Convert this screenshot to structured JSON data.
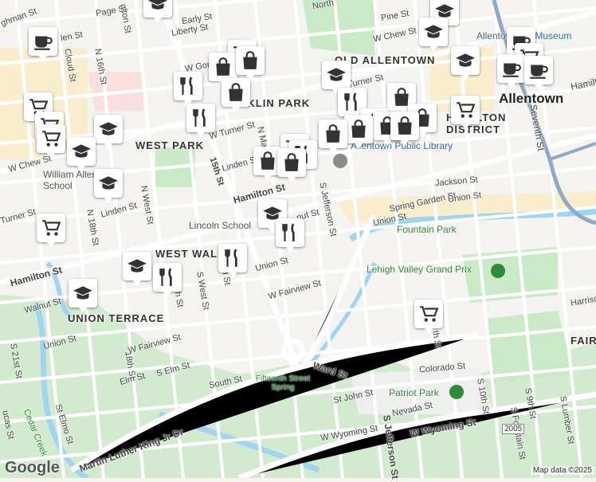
{
  "map": {
    "city_label": "Allentown",
    "neighborhoods": [
      "OLD ALLENTOWN",
      "NKLIN PARK",
      "WEST PARK",
      "HAMILTON DISTRICT",
      "WEST WALNUT",
      "UNION TERRACE",
      "FAIR"
    ],
    "streets": [
      "ghman St",
      "Page St",
      "Early St",
      "Liberty St",
      "N 16th St",
      "ulton St",
      "Cloud St",
      "len St",
      "W Gor",
      "W Chew St",
      "Pine St",
      "North",
      "Turner St",
      "W Turner St",
      "W Chew St",
      "Linden St",
      "Linden St",
      "N 18th St",
      "N West St",
      "15th St",
      "N Mar",
      "Turner St",
      "Hamilton St",
      "Hamilton St",
      "nut St",
      "S Jefferson St",
      "Jackson St",
      "Spring Garden St",
      "Union St",
      "Union St",
      "Union St",
      "Seventh St",
      "Hamilto",
      "Harriso",
      "Union St",
      "Walnut St",
      "W Fairview St",
      "W Fairview St",
      "S 16th St",
      "S West St",
      "lton St",
      "18th St",
      "S 21st St",
      "S Elm St",
      "Elm St",
      "South St",
      "Ward St",
      "Martin Luther King Jr Dr",
      "St John St",
      "Nevada St",
      "W Wyoming St",
      "W Wyoming St",
      "S Jefferson St",
      "Colorado St",
      "th St",
      "S 10th St",
      "S 9th St",
      "S Fountain St",
      "S Lumber St",
      "St Elmo St",
      "ucas St"
    ],
    "pois": {
      "art_museum": "Allentown Art Museum",
      "library": "Allentown Public Library",
      "school_allen": "William Allen High School",
      "school_lincoln": "Lincoln School",
      "fountain_park": "Fountain Park",
      "grand_prix": "Lehigh Valley Grand Prix",
      "spring": "Fifteenth Street Spring",
      "patriot_park": "Patriot Park",
      "cedar_creek": "Cedar Creek"
    },
    "route_shield": "2005",
    "attribution": "Map data ©2025",
    "logo": "Google"
  },
  "markers": [
    {
      "icon": "cart-icon"
    },
    {
      "icon": "cup-icon"
    },
    {
      "icon": "bag-icon"
    },
    {
      "icon": "school-icon"
    },
    {
      "icon": "fork-knife-icon"
    }
  ],
  "colors": {
    "water": "#9fd4f5",
    "park": "#c9e9c7",
    "road": "#ffffff",
    "highway": "#8fa9c9",
    "retail": "#fbe9b8",
    "hospital": "#fbd5d5"
  }
}
